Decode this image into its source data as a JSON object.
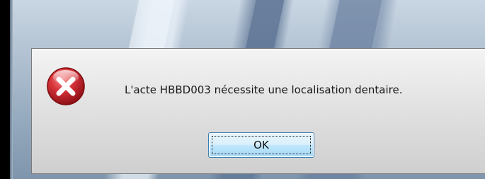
{
  "dialog": {
    "message": "L'acte HBBD003 nécessite une localisation dentaire.",
    "icon": "error-icon",
    "ok_label": "OK"
  },
  "colors": {
    "error_red": "#c0242b",
    "button_border": "#3c7fb1"
  }
}
